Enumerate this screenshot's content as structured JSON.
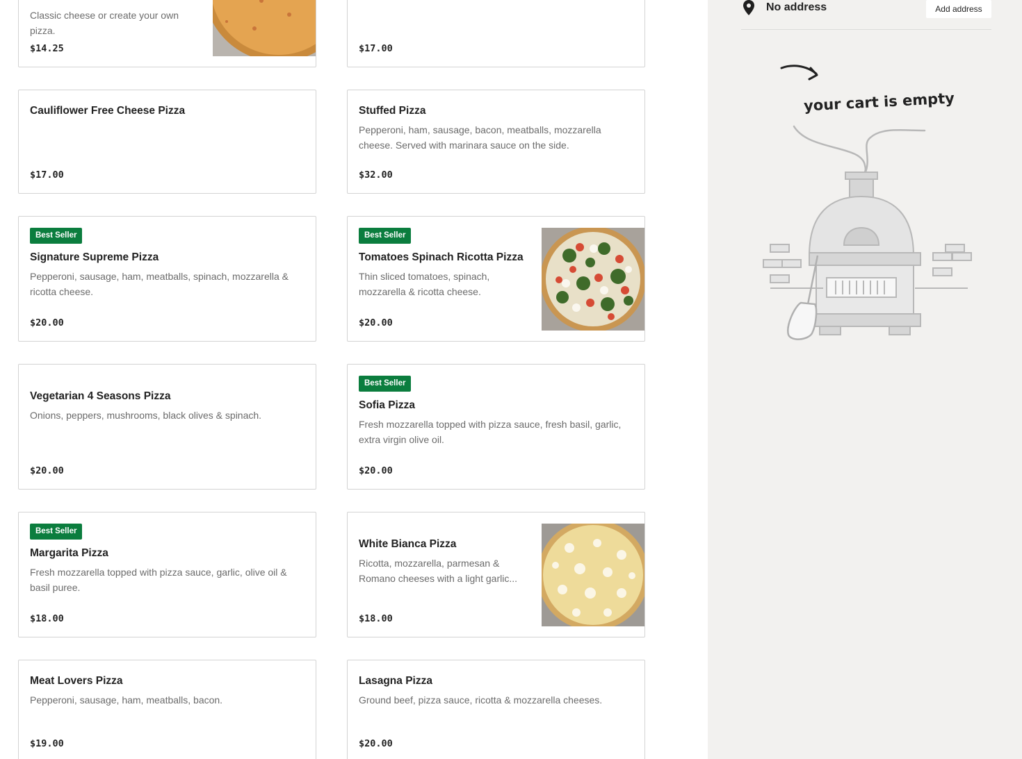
{
  "menu": {
    "items": [
      {
        "name": "",
        "description": "Classic cheese or create your own pizza.",
        "price": "$14.25",
        "badge": "",
        "has_image": true
      },
      {
        "name": "",
        "description": "",
        "price": "$17.00",
        "badge": "",
        "has_image": false
      },
      {
        "name": "Cauliflower Free Cheese Pizza",
        "description": "",
        "price": "$17.00",
        "badge": "",
        "has_image": false
      },
      {
        "name": "Stuffed Pizza",
        "description": "Pepperoni, ham, sausage, bacon, meatballs, mozzarella cheese. Served with marinara sauce on the side.",
        "price": "$32.00",
        "badge": "",
        "has_image": false
      },
      {
        "name": "Signature Supreme Pizza",
        "description": "Pepperoni, sausage, ham, meatballs, spinach, mozzarella & ricotta cheese.",
        "price": "$20.00",
        "badge": "Best Seller",
        "has_image": false
      },
      {
        "name": "Tomatoes Spinach Ricotta Pizza",
        "description": "Thin sliced tomatoes, spinach, mozzarella & ricotta cheese.",
        "price": "$20.00",
        "badge": "Best Seller",
        "has_image": true
      },
      {
        "name": "Vegetarian 4 Seasons Pizza",
        "description": "Onions, peppers, mushrooms, black olives & spinach.",
        "price": "$20.00",
        "badge": "",
        "has_image": false
      },
      {
        "name": "Sofia Pizza",
        "description": "Fresh mozzarella topped with pizza sauce, fresh basil, garlic, extra virgin olive oil.",
        "price": "$20.00",
        "badge": "Best Seller",
        "has_image": false
      },
      {
        "name": "Margarita Pizza",
        "description": "Fresh mozzarella topped with pizza sauce, garlic, olive oil & basil puree.",
        "price": "$18.00",
        "badge": "Best Seller",
        "has_image": false
      },
      {
        "name": "White Bianca Pizza",
        "description": "Ricotta, mozzarella, parmesan & Romano cheeses with a light garlic...",
        "price": "$18.00",
        "badge": "",
        "has_image": true
      },
      {
        "name": "Meat Lovers Pizza",
        "description": "Pepperoni, sausage, ham, meatballs, bacon.",
        "price": "$19.00",
        "badge": "",
        "has_image": false
      },
      {
        "name": "Lasagna Pizza",
        "description": "Ground beef, pizza sauce, ricotta & mozzarella cheeses.",
        "price": "$20.00",
        "badge": "",
        "has_image": false
      }
    ]
  },
  "sidebar": {
    "address_text": "No address",
    "add_address_label": "Add address",
    "empty_cart_text": "your cart is empty",
    "pin_icon": "location-pin-icon",
    "illustration_icon": "pizza-oven-illustration-icon"
  },
  "colors": {
    "badge": "#0b7d3e",
    "sidebar_bg": "#f2f1ef",
    "border": "#d3d3d3"
  }
}
